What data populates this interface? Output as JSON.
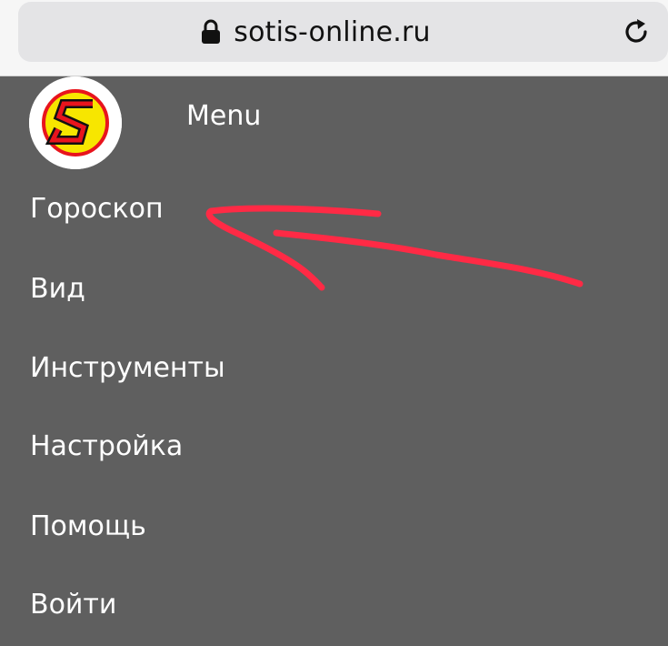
{
  "browser": {
    "url": "sotis-online.ru",
    "lock_icon": "lock-icon",
    "reload_icon": "reload-icon"
  },
  "menu": {
    "logo_icon": "sotis-logo-icon",
    "title": "Menu",
    "items": [
      {
        "label": "Гороскоп"
      },
      {
        "label": "Вид"
      },
      {
        "label": "Инструменты"
      },
      {
        "label": "Настройка"
      },
      {
        "label": "Помощь"
      },
      {
        "label": "Войти"
      }
    ]
  },
  "colors": {
    "panel_bg": "#5f5f5f",
    "menu_text": "#ffffff",
    "annotation_stroke": "#ff2a45",
    "logo_yellow": "#f7e600",
    "logo_red": "#e8141d"
  }
}
